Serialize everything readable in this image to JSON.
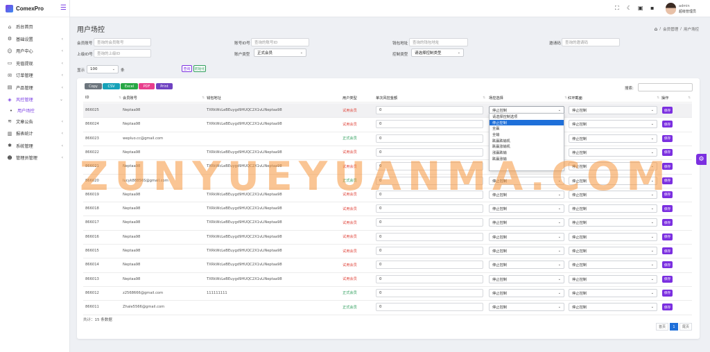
{
  "brand": {
    "name": "ComexPro"
  },
  "sidebar": {
    "items": [
      {
        "label": "后台首页",
        "icon": "home-icon"
      },
      {
        "label": "基础设置",
        "icon": "gear-icon"
      },
      {
        "label": "用户中心",
        "icon": "users-icon"
      },
      {
        "label": "充值提现",
        "icon": "card-icon"
      },
      {
        "label": "订单管理",
        "icon": "cart-icon"
      },
      {
        "label": "产品管理",
        "icon": "box-icon"
      },
      {
        "label": "风控管理",
        "icon": "shield-icon"
      },
      {
        "label": "用户场控",
        "icon": "dot-icon"
      },
      {
        "label": "文章公告",
        "icon": "layers-icon"
      },
      {
        "label": "报表统计",
        "icon": "chart-icon"
      },
      {
        "label": "系统管理",
        "icon": "cog-icon"
      },
      {
        "label": "管理员管理",
        "icon": "admin-icon"
      }
    ]
  },
  "topbar": {
    "user_name": "admin",
    "user_role": "超级管理员"
  },
  "page": {
    "title": "用户场控",
    "breadcrumb": [
      "会员管理",
      "/",
      "用户场控"
    ]
  },
  "filters": {
    "member_label": "会员账号",
    "member_ph": "查询的会员账号",
    "account_label": "账号ID号",
    "account_ph": "查询的账号ID",
    "wallet_label": "钱包地址",
    "wallet_ph": "查询的钱包地址",
    "invite_label": "邀请码",
    "invite_ph": "查询的邀请码",
    "parent_label": "上级ID号",
    "parent_ph": "查询的上级ID",
    "acctype_label": "账户类型",
    "acctype_value": "正式会员",
    "control_label": "控制类型",
    "control_value": "请选择控制类型",
    "show_label": "显示",
    "show_value": "100",
    "show_unit": "条",
    "query_btn": "查询",
    "init_btn": "初始化"
  },
  "export": [
    "Copy",
    "CSV",
    "Excel",
    "PDF",
    "Print"
  ],
  "colors": {
    "copy": "#6c757d",
    "csv": "#17a2b8",
    "excel": "#28a745",
    "pdf": "#e83e8c",
    "print": "#6f42c1",
    "accent": "#7b2fe0"
  },
  "search_label": "搜索:",
  "table": {
    "headers": [
      "ID",
      "会员账号",
      "钱包地址",
      "用户类型",
      "单次风控金额",
      "场控选择",
      "红环截面",
      "操作"
    ],
    "save_label": "保存",
    "rows": [
      {
        "id": "866025",
        "acc": "Neptaa98",
        "wallet": "TXRkWcLeBEuygd9HUQC2X1vLiNeptaa98",
        "type": "试用会员",
        "kind": "trial",
        "amt": "0",
        "ctl": "停止控制",
        "ring": "停止控制"
      },
      {
        "id": "866024",
        "acc": "Neptaa98",
        "wallet": "TXRkWcLeBEuygd9HUQC2X1vLiNeptaa98",
        "type": "试用会员",
        "kind": "trial",
        "amt": "0",
        "ctl": "",
        "ring": "停止控制"
      },
      {
        "id": "866023",
        "acc": "wepluo.cc@gmail.com",
        "wallet": "",
        "type": "正式会员",
        "kind": "formal",
        "amt": "0",
        "ctl": "",
        "ring": "停止控制"
      },
      {
        "id": "866022",
        "acc": "Neptaa98",
        "wallet": "TXRkWcLeBEuygd9HUQC2X1vLiNeptaa98",
        "type": "试用会员",
        "kind": "trial",
        "amt": "0",
        "ctl": "",
        "ring": "停止控制"
      },
      {
        "id": "866021",
        "acc": "Neptaa98",
        "wallet": "TXRkWcLeBEuygd9HUQC2X1vLiNeptaa98",
        "type": "试用会员",
        "kind": "trial",
        "amt": "0",
        "ctl": "",
        "ring": "停止控制"
      },
      {
        "id": "866020",
        "acc": "lucyk88856S@gmail.com",
        "wallet": "",
        "type": "正式会员",
        "kind": "formal",
        "amt": "0",
        "ctl": "停止控制",
        "ring": "停止控制"
      },
      {
        "id": "866019",
        "acc": "Neptaa98",
        "wallet": "TXRkWcLeBEuygd9HUQC2X1vLiNeptaa98",
        "type": "试用会员",
        "kind": "trial",
        "amt": "0",
        "ctl": "停止控制",
        "ring": "停止控制"
      },
      {
        "id": "866018",
        "acc": "Neptaa98",
        "wallet": "TXRkWcLeBEuygd9HUQC2X1vLiNeptaa98",
        "type": "试用会员",
        "kind": "trial",
        "amt": "0",
        "ctl": "停止控制",
        "ring": "停止控制"
      },
      {
        "id": "866017",
        "acc": "Neptaa98",
        "wallet": "TXRkWcLeBEuygd9HUQC2X1vLiNeptaa98",
        "type": "试用会员",
        "kind": "trial",
        "amt": "0",
        "ctl": "停止控制",
        "ring": "停止控制"
      },
      {
        "id": "866016",
        "acc": "Neptaa98",
        "wallet": "TXRkWcLeBEuygd9HUQC2X1vLiNeptaa98",
        "type": "试用会员",
        "kind": "trial",
        "amt": "0",
        "ctl": "停止控制",
        "ring": "停止控制"
      },
      {
        "id": "866015",
        "acc": "Neptaa98",
        "wallet": "TXRkWcLeBEuygd9HUQC2X1vLiNeptaa98",
        "type": "试用会员",
        "kind": "trial",
        "amt": "0",
        "ctl": "停止控制",
        "ring": "停止控制"
      },
      {
        "id": "866014",
        "acc": "Neptaa98",
        "wallet": "TXRkWcLeBEuygd9HUQC2X1vLiNeptaa98",
        "type": "试用会员",
        "kind": "trial",
        "amt": "0",
        "ctl": "停止控制",
        "ring": "停止控制"
      },
      {
        "id": "866013",
        "acc": "Neptaa98",
        "wallet": "TXRkWcLeBEuygd9HUQC2X1vLiNeptaa98",
        "type": "试用会员",
        "kind": "trial",
        "amt": "0",
        "ctl": "停止控制",
        "ring": "停止控制"
      },
      {
        "id": "866012",
        "acc": "z2568666@gmail.com",
        "wallet": "111111111",
        "type": "正式会员",
        "kind": "formal",
        "amt": "0",
        "ctl": "停止控制",
        "ring": "停止控制"
      },
      {
        "id": "866011",
        "acc": "Zhale5566@gmail.com",
        "wallet": "",
        "type": "正式会员",
        "kind": "formal",
        "amt": "0",
        "ctl": "停止控制",
        "ring": "停止控制"
      }
    ]
  },
  "dropdown_options": [
    "请选择控制选项",
    "停止控制",
    "全赢",
    "全输",
    "跌赢跌输机",
    "跌赢涨输机",
    "涨赢跌输",
    "跌赢涨输"
  ],
  "dropdown_selected": "停止控制",
  "footer": {
    "total": "共计：15 条数据",
    "first": "首页",
    "page": "1",
    "last": "尾页"
  },
  "watermark": "ZUNYUEYUANMA.COM"
}
